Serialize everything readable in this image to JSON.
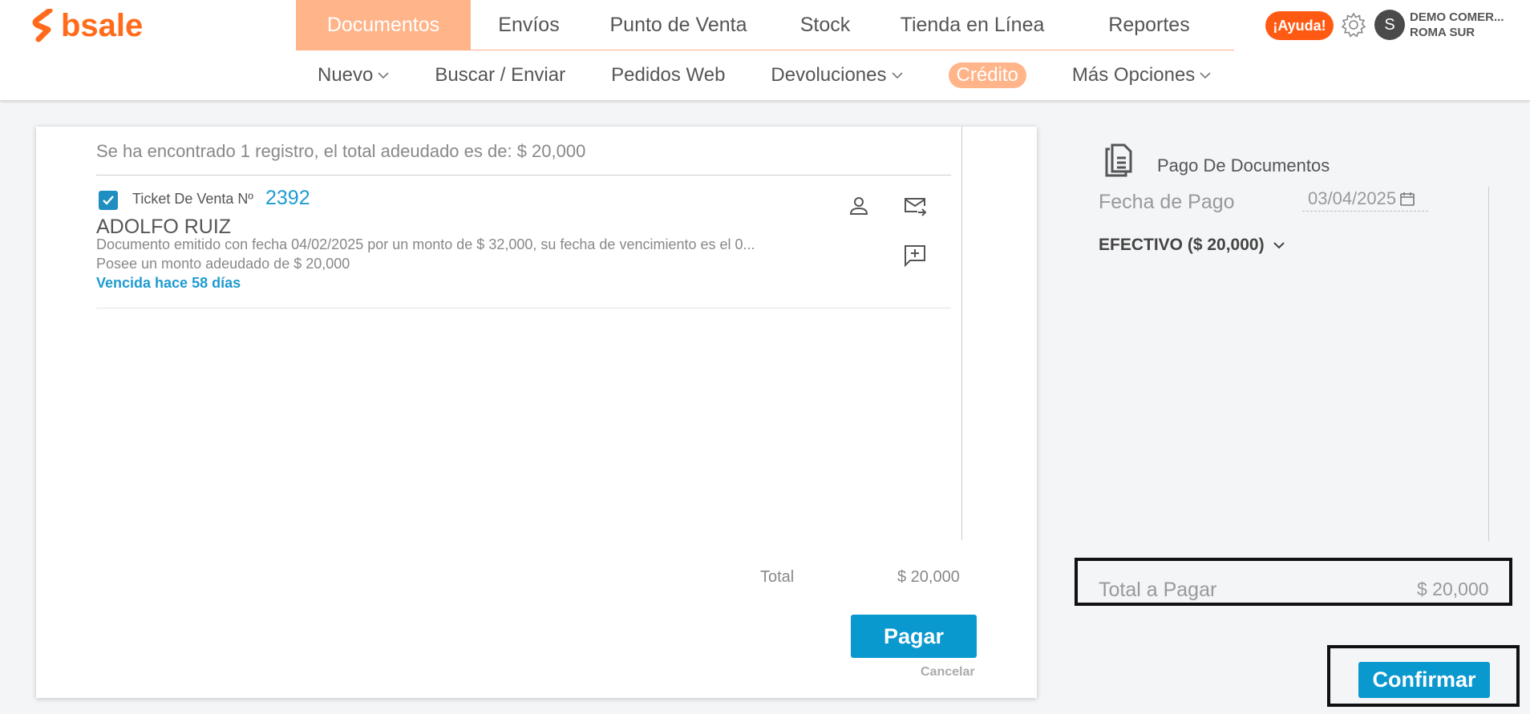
{
  "brand": {
    "name": "bsale",
    "color": "#ff6b1a"
  },
  "nav": {
    "items": [
      {
        "label": "Documentos",
        "active": true
      },
      {
        "label": "Envíos"
      },
      {
        "label": "Punto de Venta"
      },
      {
        "label": "Stock"
      },
      {
        "label": "Tienda en Línea"
      },
      {
        "label": "Reportes"
      }
    ],
    "active_color": "#ffb48a"
  },
  "header": {
    "help_label": "¡Ayuda!",
    "help_color": "#ff5a14",
    "avatar_initial": "S",
    "company_line1": "DEMO COMER...",
    "company_line2": "ROMA SUR"
  },
  "subnav": {
    "items": [
      {
        "label": "Nuevo",
        "dropdown": true
      },
      {
        "label": "Buscar / Enviar"
      },
      {
        "label": "Pedidos Web"
      },
      {
        "label": "Devoluciones",
        "dropdown": true
      },
      {
        "label": "Crédito",
        "active": true
      },
      {
        "label": "Más Opciones",
        "dropdown": true
      }
    ]
  },
  "results": {
    "summary": "Se ha encontrado 1 registro, el total adeudado es de: $ 20,000",
    "document": {
      "checked": true,
      "type_label": "Ticket De Venta Nº",
      "number": "2392",
      "client": "ADOLFO RUIZ",
      "description": "Documento emitido con fecha 04/02/2025 por un monto de $ 32,000, su fecha de vencimiento es el 0...",
      "owed": "Posee un monto adeudado de $ 20,000",
      "overdue": "Vencida hace 58 días",
      "icons": [
        "person-icon",
        "email-send-icon",
        "add-comment-icon"
      ]
    },
    "total_label": "Total",
    "total_value": "$ 20,000",
    "pay_label": "Pagar",
    "cancel_label": "Cancelar"
  },
  "payment": {
    "title": "Pago De Documentos",
    "date_label": "Fecha de Pago",
    "date_value": "03/04/2025",
    "method": "EFECTIVO ($ 20,000)",
    "total_label": "Total a Pagar",
    "total_value": "$ 20,000",
    "confirm_label": "Confirmar"
  },
  "colors": {
    "primary_button": "#0a99cf",
    "link": "#1f9bd1"
  }
}
